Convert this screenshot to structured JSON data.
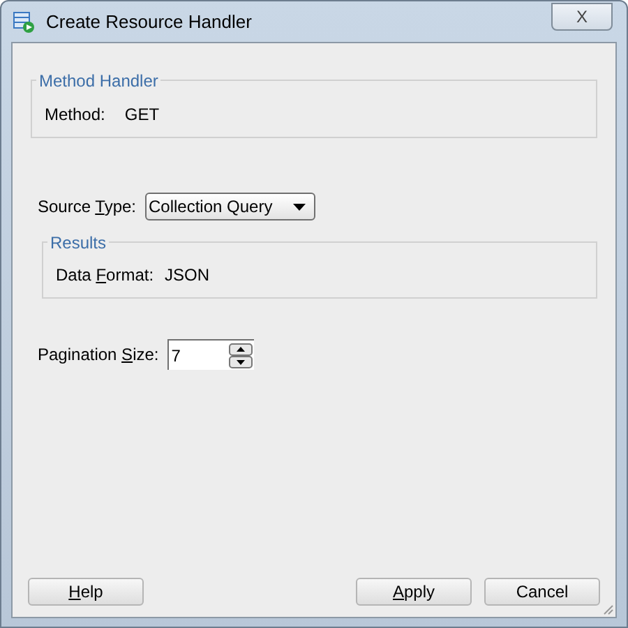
{
  "window": {
    "title": "Create Resource Handler",
    "close_label": "X"
  },
  "method_handler": {
    "legend": "Method Handler",
    "label": "Method:",
    "value": "GET"
  },
  "source_type": {
    "label": {
      "before": "Source ",
      "key": "T",
      "after": "ype:"
    },
    "value": "Collection Query"
  },
  "results": {
    "legend": "Results",
    "label": {
      "before": "Data ",
      "key": "F",
      "after": "ormat:"
    },
    "value": "JSON"
  },
  "pagination_size": {
    "label": {
      "before": "Pagination ",
      "key": "S",
      "after": "ize:"
    },
    "value": "7"
  },
  "buttons": [
    {
      "kind": "help",
      "label": {
        "key": "H",
        "after": "elp"
      }
    },
    {
      "kind": "apply",
      "label": {
        "key": "A",
        "after": "pply"
      }
    },
    {
      "kind": "cancel",
      "label": {
        "before": "Cancel"
      }
    }
  ]
}
